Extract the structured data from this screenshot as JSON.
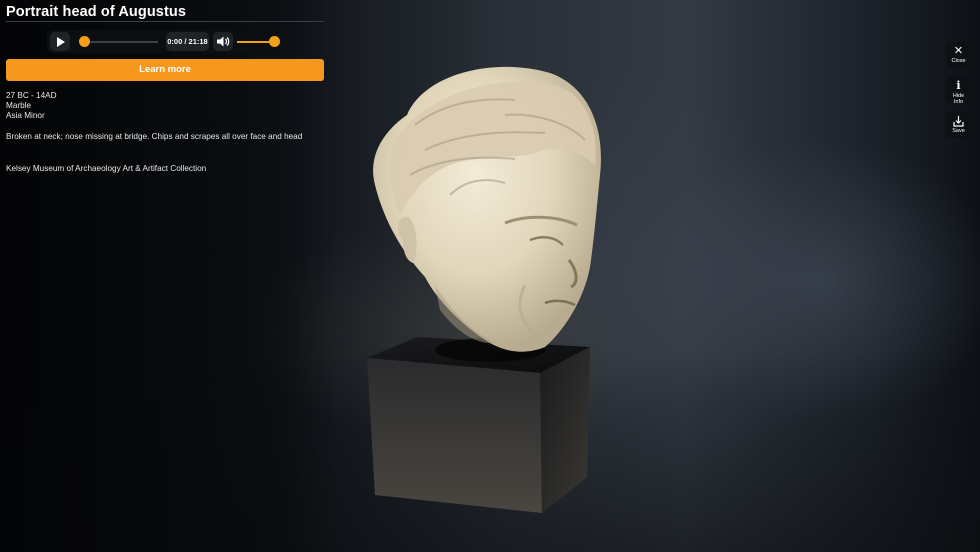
{
  "title": "Portrait head of Augustus",
  "player": {
    "time": "0:00 / 21:18",
    "progress": 0.0,
    "volume": 1.0,
    "play_icon": "play-icon",
    "volume_icon": "speaker-icon"
  },
  "learn_more_label": "Learn more",
  "details": {
    "date": "27 BC - 14AD",
    "material": "Marble",
    "origin": "Asia Minor",
    "condition": "Broken at neck; nose missing at bridge. Chips and scrapes all over face and head",
    "collection": "Kelsey Museum of Archaeology Art & Artifact Collection"
  },
  "side_buttons": [
    {
      "icon": "close-icon",
      "label": "Close"
    },
    {
      "icon": "info-icon",
      "label": "Hide Info"
    },
    {
      "icon": "save-icon",
      "label": "Save"
    }
  ],
  "colors": {
    "accent": "#f6971e",
    "panel": "#0c0e11"
  }
}
